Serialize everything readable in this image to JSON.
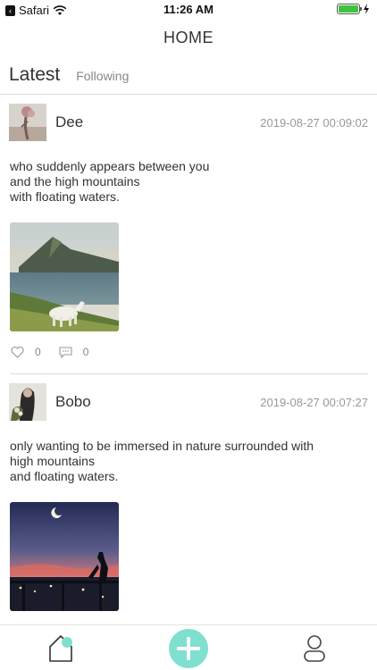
{
  "status_bar": {
    "back_app": "Safari",
    "time": "11:26 AM",
    "battery_level": 1.0,
    "battery_color": "#3ec33e"
  },
  "nav": {
    "title": "HOME"
  },
  "tabs": {
    "active": "Latest",
    "inactive": "Following"
  },
  "posts": [
    {
      "user": "Dee",
      "time": "2019-08-27 00:09:02",
      "text": "who suddenly appears between you\nand the high mountains\nwith floating waters.",
      "likes": "0",
      "comments": "0"
    },
    {
      "user": "Bobo",
      "time": "2019-08-27 00:07:27",
      "text": "only wanting to be immersed in nature surrounded with\nhigh mountains\nand floating waters."
    }
  ],
  "tabbar": {
    "home_icon": "home-icon",
    "add_icon": "add-post-icon",
    "profile_icon": "profile-icon",
    "accent": "#7fe0cf"
  }
}
